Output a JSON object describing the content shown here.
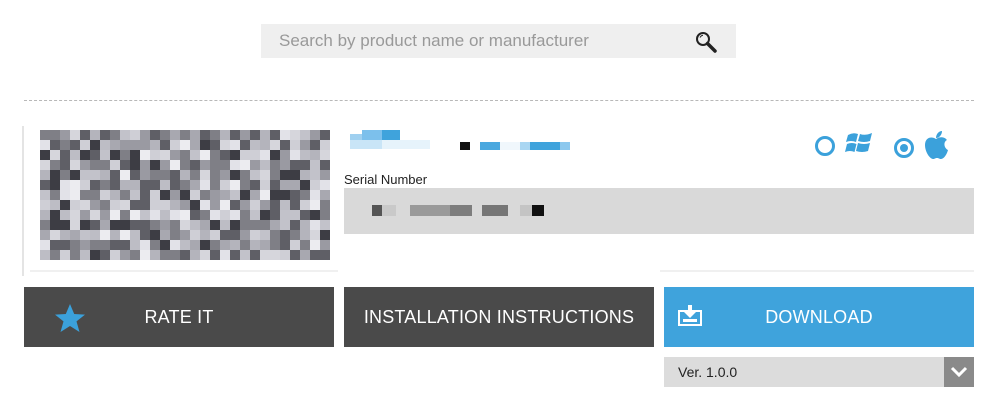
{
  "search": {
    "placeholder": "Search by product name or manufacturer",
    "value": ""
  },
  "product": {
    "serial_label": "Serial Number"
  },
  "os_options": [
    {
      "name": "windows",
      "selected": false
    },
    {
      "name": "apple",
      "selected": true
    }
  ],
  "actions": {
    "rate_label": "RATE IT",
    "install_label": "INSTALLATION INSTRUCTIONS",
    "download_label": "DOWNLOAD"
  },
  "version": {
    "selected": "Ver. 1.0.0"
  },
  "colors": {
    "accent": "#3fa3dc",
    "dark_button": "#4a4a4a",
    "serial_bg": "#d9d9d9"
  }
}
